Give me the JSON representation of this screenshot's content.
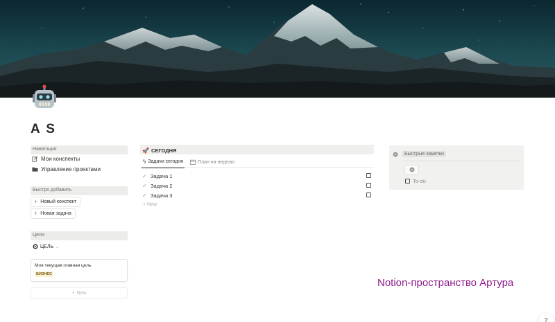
{
  "page": {
    "title": "A S",
    "icon": "robot-icon",
    "cover": "mountains-at-night"
  },
  "navigation": {
    "header": "Навигация",
    "items": [
      {
        "label": "Мои конспекты",
        "icon": "edit-note-icon"
      },
      {
        "label": "Управление проектами",
        "icon": "folder-icon"
      }
    ]
  },
  "quick_add": {
    "header": "Быстро добавить",
    "buttons": [
      {
        "label": "Новый конспект"
      },
      {
        "label": "Новая задача"
      }
    ]
  },
  "goals": {
    "header": "Цели",
    "select_label": "ЦЕЛЬ",
    "card": {
      "text": "Моя текущая главная цель",
      "tag": "БИЗНЕС"
    },
    "new_label": "New"
  },
  "today": {
    "header": "СЕГОДНЯ",
    "tabs": [
      {
        "label": "Задачи сегодня",
        "active": true
      },
      {
        "label": "План на неделю",
        "active": false
      }
    ],
    "tasks": [
      {
        "label": "Задача 1",
        "checked": false
      },
      {
        "label": "Задача 2",
        "checked": false
      },
      {
        "label": "Задача 3",
        "checked": false
      }
    ],
    "new_label": "+ New"
  },
  "quick_notes": {
    "header": "Быстрые заметки",
    "todo_label": "To-do"
  },
  "brand_text": "Notion-пространство Артура",
  "help_label": "?",
  "colors": {
    "brand": "#8d1c8c",
    "tag_bg": "#fbf1d3",
    "tag_text": "#7a5a17",
    "section_bg": "#ececea"
  }
}
